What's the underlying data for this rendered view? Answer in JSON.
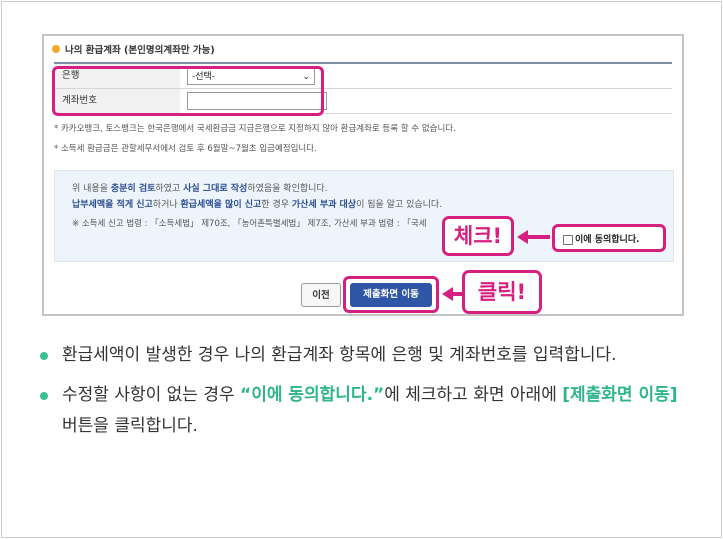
{
  "form": {
    "section_title": "나의 환급계좌 (본인명의계좌만 가능)",
    "bank_label": "은행",
    "bank_selected": "-선택-",
    "account_label": "계좌번호",
    "account_value": ""
  },
  "notes": [
    "* 카카오뱅크, 토스뱅크는 한국은행에서 국세환급금 지급은행으로 지정하지 않아 환급계좌로 등록 할 수 없습니다.",
    "* 소득세 환급금은 관할세무서에서 검토 후 6월말~7월초 입금예정입니다."
  ],
  "agreement": {
    "line1_a": "위 내용을 ",
    "line1_b": "충분히 검토",
    "line1_c": "하였고 ",
    "line1_d": "사실 그대로 작성",
    "line1_e": "하였음을 확인합니다.",
    "line2_a": "납부세액을 적게 신고",
    "line2_b": "하거나 ",
    "line2_c": "환급세액을 많이 신고",
    "line2_d": "한 경우 ",
    "line2_e": "가산세 부과 대상",
    "line2_f": "이 됨을 알고 있습니다.",
    "law_text": "※ 소득세 신고 법령 : 「소득세법」 제70조, 「농어촌특별세법」 제7조, 가산세 부과 법령 : 「국세",
    "checkbox_label": "이에 동의합니다.",
    "checked": false
  },
  "buttons": {
    "prev": "이전",
    "submit": "제출화면 이동"
  },
  "callouts": {
    "check": "체크!",
    "click": "클릭!"
  },
  "instructions": {
    "b1": "환급세액이 발생한 경우 나의 환급계좌 항목에 은행 및 계좌번호를 입력합니다.",
    "b2_a": "수정할 사항이 없는 경우 ",
    "b2_b": "“이에 동의합니다.”",
    "b2_c": "에 체크하고 화면 아래에 ",
    "b2_d": "[제출화면 이동]",
    "b2_e": " 버튼을 클릭합니다."
  },
  "colors": {
    "highlight": "#d6207f",
    "accent_green": "#2fb58b",
    "button_blue": "#2f56a6"
  }
}
